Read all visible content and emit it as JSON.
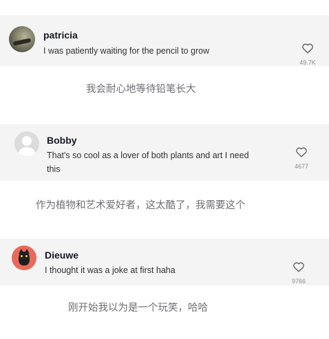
{
  "comments": [
    {
      "username": "patricia",
      "text": "I was patiently waiting for the pencil to grow",
      "likes": "49.7K",
      "avatar_icon": "user-photo-avatar",
      "translation": "我会耐心地等待铅笔长大"
    },
    {
      "username": "Bobby",
      "text": "That's so cool as a lover of both plants and art I need this",
      "text_line1": "That's so cool as a lover of both plants and art I need",
      "text_line2": "this",
      "likes": "4677",
      "avatar_icon": "default-user-avatar",
      "translation": "作为植物和艺术爱好者，这太酷了，我需要这个"
    },
    {
      "username": "Dieuwe",
      "text": "I thought it was a joke at first haha",
      "likes": "9766",
      "avatar_icon": "cat-avatar",
      "translation": "刚开始我以为是一个玩笑，哈哈"
    }
  ],
  "icons": {
    "like": "heart-outline-icon"
  },
  "colors": {
    "card_bg": "#f4f4f4",
    "text": "#161823",
    "muted": "#8a8b91"
  }
}
